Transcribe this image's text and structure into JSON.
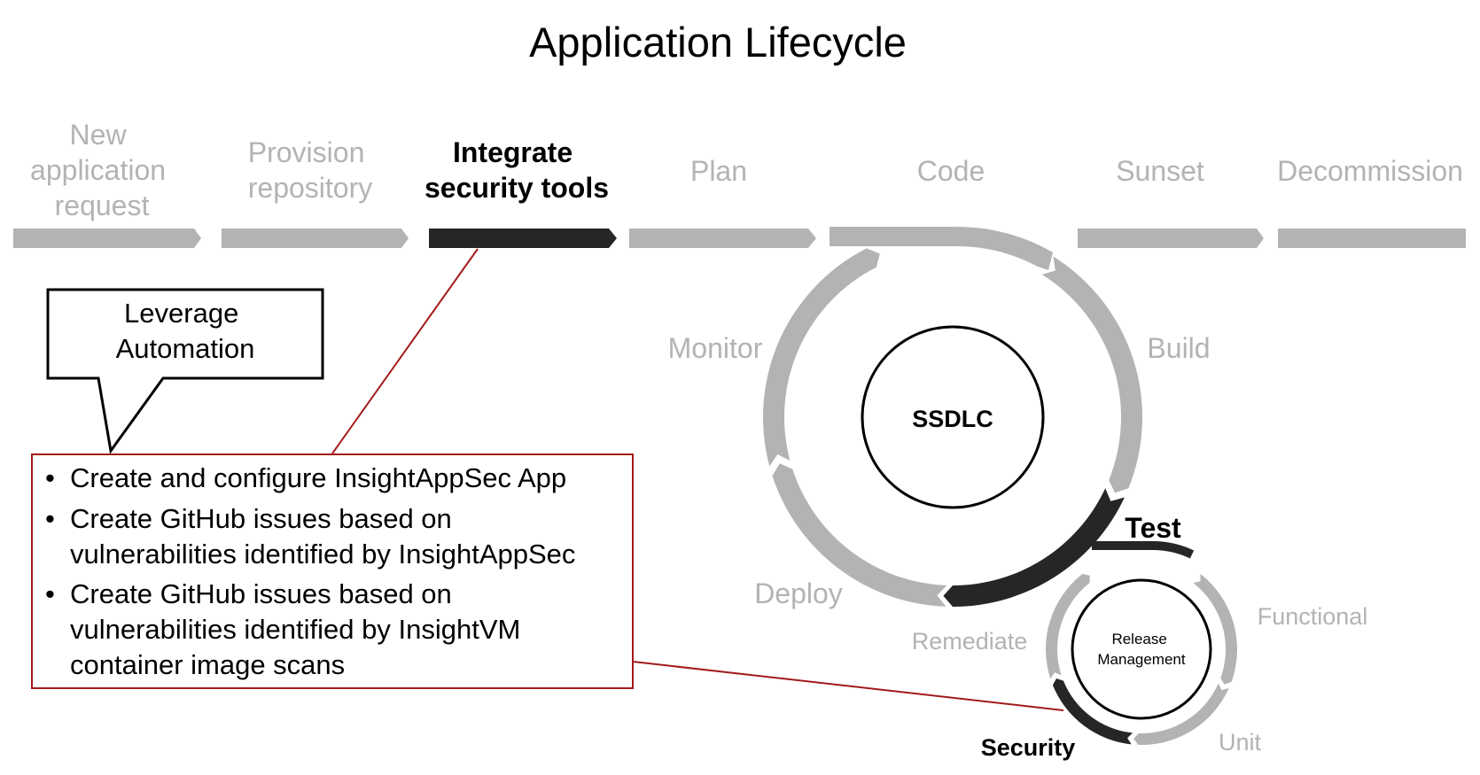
{
  "title": "Application Lifecycle",
  "colors": {
    "inactive": "#b3b3b3",
    "active": "#262626",
    "text": "#000000",
    "connector": "#a31a1a",
    "box_border": "#a31a1a"
  },
  "stages": [
    {
      "lines": [
        "New",
        "application",
        "request"
      ],
      "active": false
    },
    {
      "lines": [
        "Provision",
        "repository"
      ],
      "active": false
    },
    {
      "lines": [
        "Integrate",
        "security tools"
      ],
      "active": true
    },
    {
      "lines": [
        "Plan"
      ],
      "active": false
    },
    {
      "lines": [
        "Code"
      ],
      "active": false
    },
    {
      "lines": [
        "Sunset"
      ],
      "active": false
    },
    {
      "lines": [
        "Decommission"
      ],
      "active": false
    }
  ],
  "callout": {
    "lines": [
      "Leverage",
      "Automation"
    ]
  },
  "details_box": {
    "bullets": [
      {
        "lines": [
          "Create and configure InsightAppSec App"
        ]
      },
      {
        "lines": [
          "Create GitHub issues based on",
          "vulnerabilities identified by InsightAppSec"
        ]
      },
      {
        "lines": [
          "Create GitHub issues based on",
          "vulnerabilities identified by InsightVM",
          "container image scans"
        ]
      }
    ]
  },
  "ssdlc": {
    "center_label": "SSDLC",
    "phases": [
      {
        "label": "Build",
        "active": false
      },
      {
        "label": "Test",
        "active": true
      },
      {
        "label": "Deploy",
        "active": false
      },
      {
        "label": "Monitor",
        "active": false
      }
    ]
  },
  "release_management": {
    "center_lines": [
      "Release",
      "Management"
    ],
    "phases": [
      {
        "label": "Functional",
        "active": false
      },
      {
        "label": "Unit",
        "active": false
      },
      {
        "label": "Security",
        "active": true
      },
      {
        "label": "Remediate",
        "active": false
      }
    ]
  }
}
